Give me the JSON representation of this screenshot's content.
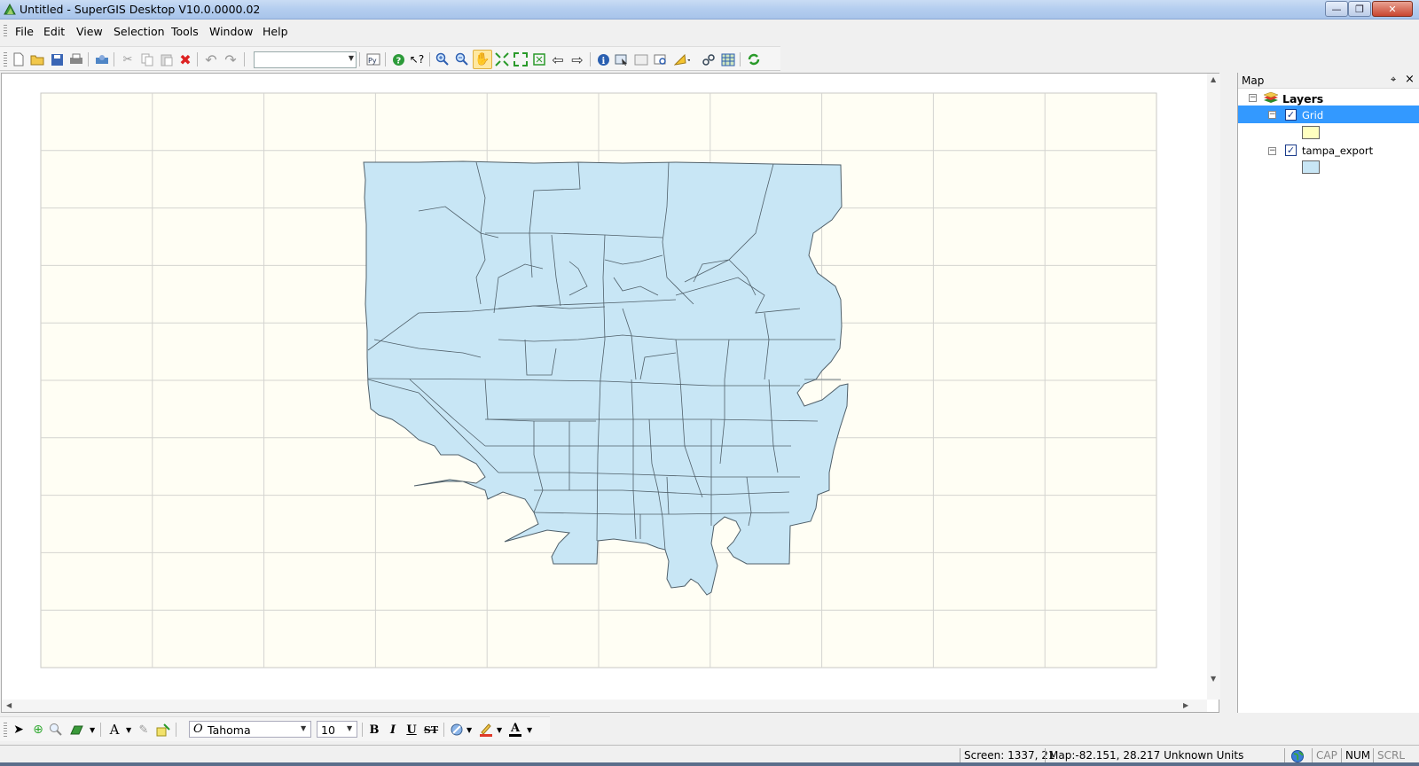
{
  "window": {
    "title": "Untitled - SuperGIS Desktop V10.0.0000.02",
    "app_icon": "supergis-icon",
    "minimize_glyph": "—",
    "maximize_glyph": "❐",
    "close_glyph": "✕"
  },
  "menu": {
    "items": [
      "File",
      "Edit",
      "View",
      "Selection",
      "Tools",
      "Window",
      "Help"
    ]
  },
  "toolbar": {
    "icons": [
      "new-file-icon",
      "open-folder-icon",
      "save-icon",
      "print-icon",
      "print-preview-icon",
      "cut-icon",
      "copy-icon",
      "paste-icon",
      "delete-icon",
      "undo-icon",
      "redo-icon",
      "python-icon",
      "help-icon",
      "context-help-icon",
      "zoom-in-icon",
      "zoom-out-icon",
      "pan-icon",
      "full-extent-icon",
      "fixed-zoom-icon",
      "zoom-to-layer-icon",
      "back-extent-icon",
      "forward-extent-icon",
      "identify-icon",
      "select-features-icon",
      "clear-selection-icon",
      "find-icon",
      "measure-icon",
      "hyperlink-icon",
      "overview-icon",
      "refresh-icon"
    ],
    "scale_value": ""
  },
  "toc": {
    "title": "Map",
    "pin_glyph": "⌖",
    "close_glyph": "×",
    "root_label": "Layers",
    "layers": [
      {
        "name": "Grid",
        "checked": true,
        "selected": true,
        "swatch": "#ffffc0"
      },
      {
        "name": "tampa_export",
        "checked": true,
        "selected": false,
        "swatch": "#c8e6f5"
      }
    ]
  },
  "map": {
    "background": "#fffef4",
    "grid_line": "#d4d4d0",
    "polygon_fill": "#c8e6f5",
    "polygon_stroke": "#50606a"
  },
  "drawbar": {
    "font_name": "Tahoma",
    "font_size": "10",
    "bold": "B",
    "italic": "I",
    "underline": "U",
    "strike": "ST",
    "text_glyph": "A",
    "font_color_glyph": "A"
  },
  "status": {
    "screen": "Screen: 1337, 21",
    "map_coords": "Map:-82.151, 28.217 Unknown Units",
    "cap": "CAP",
    "num": "NUM",
    "scrl": "SCRL"
  }
}
